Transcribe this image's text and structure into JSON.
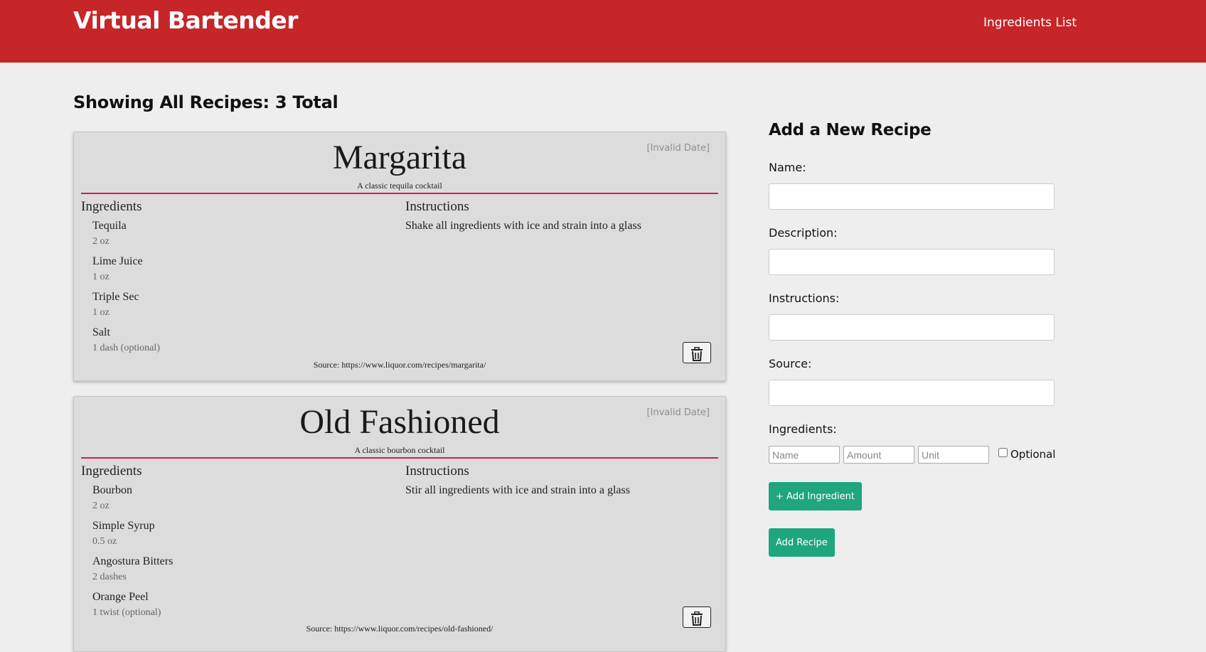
{
  "app": {
    "brand": "Virtual Bartender",
    "nav_link": "Ingredients List"
  },
  "page": {
    "heading": "Showing All Recipes: 3 Total"
  },
  "recipes": [
    {
      "name": "Margarita",
      "date": "[Invalid Date]",
      "description": "A classic tequila cocktail",
      "ingredients_label": "Ingredients",
      "instructions_label": "Instructions",
      "ingredients": [
        {
          "name": "Tequila",
          "amount": "2 oz"
        },
        {
          "name": "Lime Juice",
          "amount": "1 oz"
        },
        {
          "name": "Triple Sec",
          "amount": "1 oz"
        },
        {
          "name": "Salt",
          "amount": "1 dash (optional)"
        }
      ],
      "instructions": "Shake all ingredients with ice and strain into a glass",
      "source": "Source: https://www.liquor.com/recipes/margarita/"
    },
    {
      "name": "Old Fashioned",
      "date": "[Invalid Date]",
      "description": "A classic bourbon cocktail",
      "ingredients_label": "Ingredients",
      "instructions_label": "Instructions",
      "ingredients": [
        {
          "name": "Bourbon",
          "amount": "2 oz"
        },
        {
          "name": "Simple Syrup",
          "amount": "0.5 oz"
        },
        {
          "name": "Angostura Bitters",
          "amount": "2 dashes"
        },
        {
          "name": "Orange Peel",
          "amount": "1 twist (optional)"
        }
      ],
      "instructions": "Stir all ingredients with ice and strain into a glass",
      "source": "Source: https://www.liquor.com/recipes/old-fashioned/"
    }
  ],
  "form": {
    "title": "Add a New Recipe",
    "name_label": "Name:",
    "name_value": "",
    "description_label": "Description:",
    "description_value": "",
    "instructions_label": "Instructions:",
    "instructions_value": "",
    "source_label": "Source:",
    "source_value": "",
    "ingredients_label": "Ingredients:",
    "ingredient_name_placeholder": "Name",
    "ingredient_amount_placeholder": "Amount",
    "ingredient_unit_placeholder": "Unit",
    "optional_label": "Optional",
    "optional_checked": false,
    "add_ingredient_label": "+ Add Ingredient",
    "add_recipe_label": "Add Recipe"
  },
  "icons": {
    "delete": "trash-icon"
  },
  "colors": {
    "navbar": "#c62628",
    "accent_rule": "#d81b50",
    "button_green": "#1fa67e",
    "page_bg": "#eeeeef",
    "card_bg": "#dcdcdc"
  }
}
